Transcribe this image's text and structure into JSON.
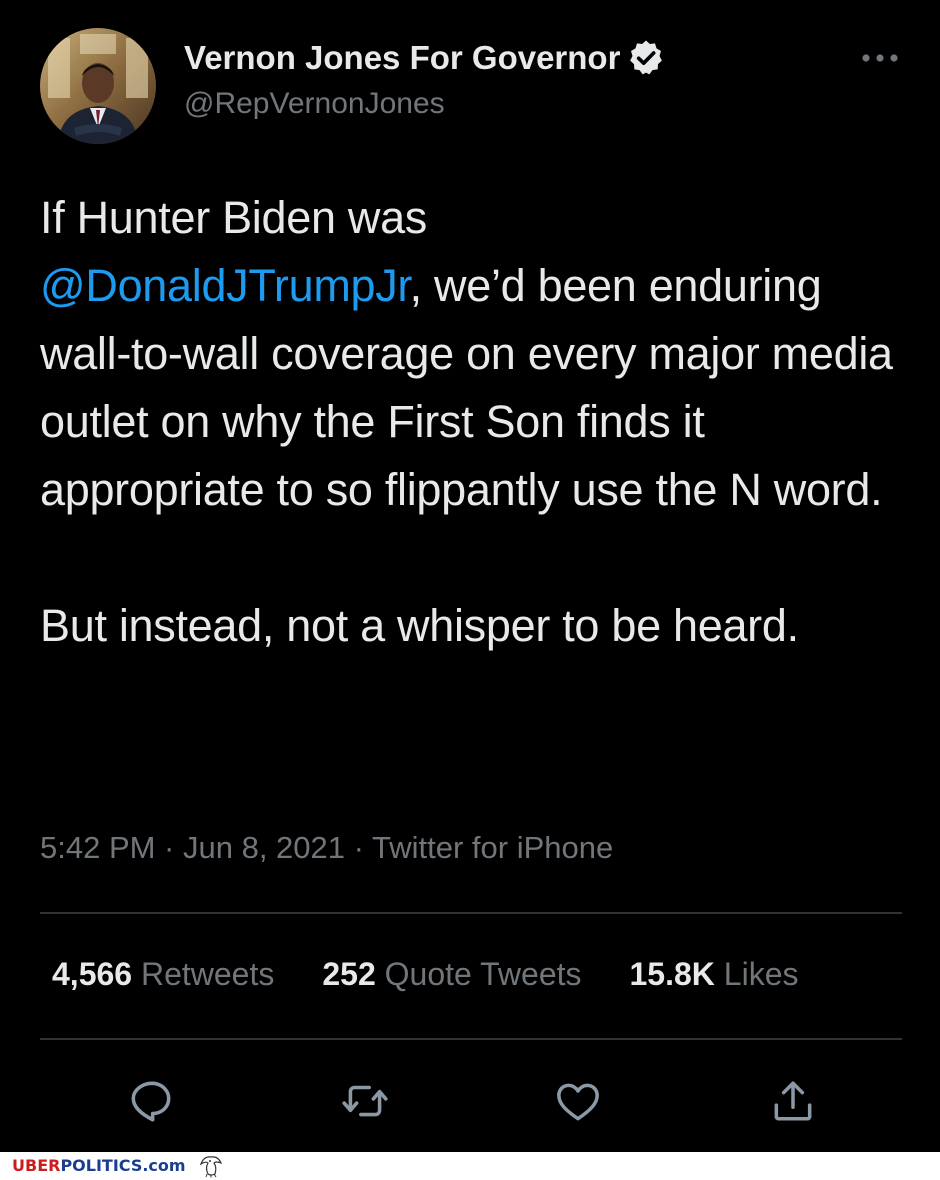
{
  "tweet": {
    "display_name": "Vernon Jones For Governor",
    "handle": "@RepVernonJones",
    "text": {
      "line1_prefix": "If Hunter Biden was",
      "mention": "@DonaldJTrumpJr",
      "line2_suffix": ", we’d been enduring wall-to-wall coverage on every major media outlet on why the First Son finds it appropriate to so flippantly use the N word.",
      "paragraph2": "But instead, not a whisper to be heard."
    },
    "meta": "5:42 PM · Jun 8, 2021 · Twitter for iPhone",
    "stats": {
      "retweets_count": "4,566",
      "retweets_label": "Retweets",
      "quotes_count": "252",
      "quotes_label": "Quote Tweets",
      "likes_count": "15.8K",
      "likes_label": "Likes"
    },
    "icons": {
      "verified": "verified-badge-icon",
      "more": "more-options-icon",
      "reply": "reply-icon",
      "retweet": "retweet-icon",
      "like": "like-icon",
      "share": "share-icon"
    }
  },
  "footer": {
    "brand_part1": "UBER",
    "brand_part2": "POLITICS.com"
  },
  "colors": {
    "background": "#000000",
    "text": "#e7e9ea",
    "secondary": "#71767b",
    "mention": "#1d9bf0",
    "divider": "#2f3336",
    "brand_red": "#cc1d1d",
    "brand_blue": "#1b3d8f"
  }
}
